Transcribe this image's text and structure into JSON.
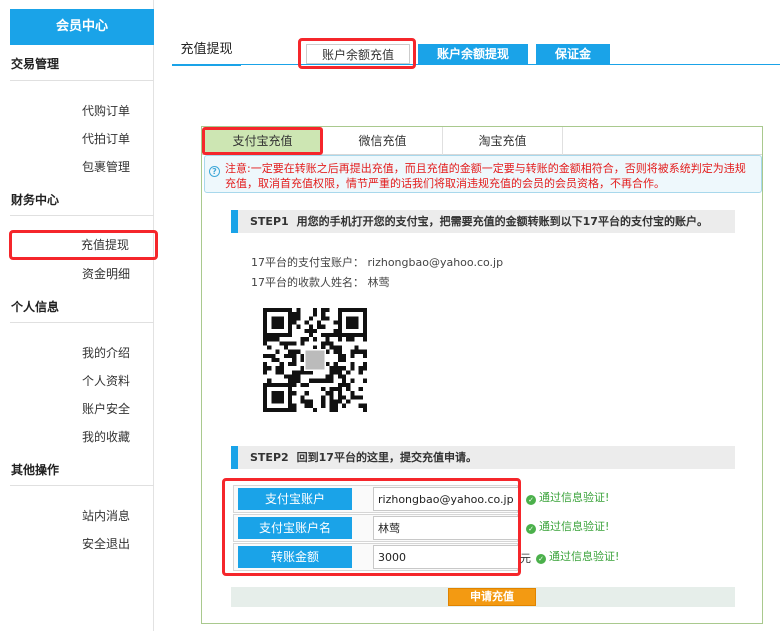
{
  "sidebar": {
    "title": "会员中心",
    "sections": [
      {
        "title": "交易管理",
        "items": [
          "代购订单",
          "代拍订单",
          "包裹管理"
        ]
      },
      {
        "title": "财务中心",
        "items": [
          "充值提现",
          "资金明细"
        ]
      },
      {
        "title": "个人信息",
        "items": [
          "我的介绍",
          "个人资料",
          "账户安全",
          "我的收藏"
        ]
      },
      {
        "title": "其他操作",
        "items": [
          "站内消息",
          "安全退出"
        ]
      }
    ],
    "active_item": "充值提现"
  },
  "top": {
    "title": "充值提现",
    "tabs": [
      "账户余额充值",
      "账户余额提现",
      "保证金"
    ],
    "current_tab": "账户余额充值"
  },
  "inner_tabs": [
    "支付宝充值",
    "微信充值",
    "淘宝充值"
  ],
  "notice": "注意:一定要在转账之后再提出充值，而且充值的金额一定要与转账的金额相符合，否则将被系统判定为违规充值，取消首充值权限，情节严重的话我们将取消违规充值的会员的会员资格，不再合作。",
  "step1": {
    "num": "STEP1",
    "text": "用您的手机打开您的支付宝，把需要充值的金额转账到以下17平台的支付宝的账户。",
    "account_line": "17平台的支付宝账户： rizhongbao@yahoo.co.jp",
    "name_line": "17平台的收款人姓名： 林莺"
  },
  "step2": {
    "num": "STEP2",
    "text": "回到17平台的这里，提交充值申请。"
  },
  "form": {
    "fields": [
      {
        "label": "支付宝账户",
        "value": "rizhongbao@yahoo.co.jp",
        "ok": "通过信息验证!"
      },
      {
        "label": "支付宝账户名",
        "value": "林莺",
        "ok": "通过信息验证!"
      },
      {
        "label": "转账金额",
        "value": "3000",
        "ok": "通过信息验证!"
      }
    ],
    "unit": "元",
    "submit": "申请充值"
  },
  "colors": {
    "accent": "#1aa3e8",
    "highlight": "#f5262b",
    "button": "#f39a12",
    "ok": "#3aa33a"
  }
}
